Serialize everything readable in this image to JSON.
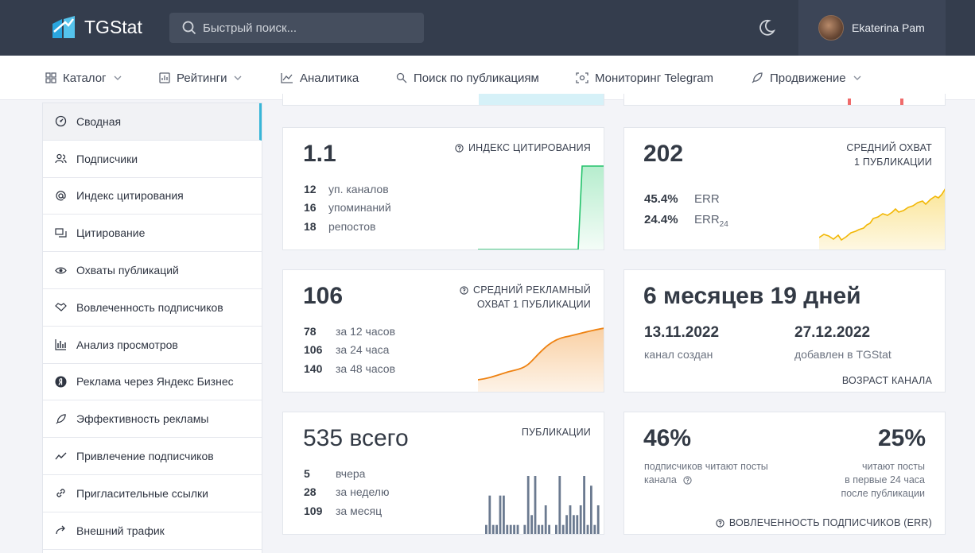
{
  "app": {
    "name": "TGStat"
  },
  "search": {
    "placeholder": "Быстрый поиск..."
  },
  "user": {
    "name": "Ekaterina Pam"
  },
  "nav": [
    {
      "label": "Каталог",
      "icon": "grid-icon",
      "dropdown": true
    },
    {
      "label": "Рейтинги",
      "icon": "bar-chart-icon",
      "dropdown": true
    },
    {
      "label": "Аналитика",
      "icon": "line-chart-icon",
      "dropdown": false
    },
    {
      "label": "Поиск по публикациям",
      "icon": "search-icon",
      "dropdown": false
    },
    {
      "label": "Мониторинг Telegram",
      "icon": "monitor-icon",
      "dropdown": false
    },
    {
      "label": "Продвижение",
      "icon": "rocket-icon",
      "dropdown": true
    }
  ],
  "sidebar": [
    {
      "label": "Сводная",
      "icon": "dashboard-icon",
      "active": true
    },
    {
      "label": "Подписчики",
      "icon": "users-icon"
    },
    {
      "label": "Индекс цитирования",
      "icon": "at-icon"
    },
    {
      "label": "Цитирование",
      "icon": "quote-icon"
    },
    {
      "label": "Охваты публикаций",
      "icon": "eye-icon"
    },
    {
      "label": "Вовлеченность подписчиков",
      "icon": "handshake-icon"
    },
    {
      "label": "Анализ просмотров",
      "icon": "bars-icon"
    },
    {
      "label": "Реклама через Яндекс Бизнес",
      "icon": "yandex-icon"
    },
    {
      "label": "Эффективность рекламы",
      "icon": "rocket-icon"
    },
    {
      "label": "Привлечение подписчиков",
      "icon": "trend-icon"
    },
    {
      "label": "Пригласительные ссылки",
      "icon": "link-icon"
    },
    {
      "label": "Внешний трафик",
      "icon": "share-icon"
    }
  ],
  "cards": {
    "citation": {
      "title": "ИНДЕКС ЦИТИРОВАНИЯ",
      "value": "1.1",
      "rows": [
        {
          "num": "12",
          "label": "уп. каналов"
        },
        {
          "num": "16",
          "label": "упоминаний"
        },
        {
          "num": "18",
          "label": "репостов"
        }
      ],
      "spark_color": "#2ecc71"
    },
    "reach": {
      "title_line1": "СРЕДНИЙ ОХВАТ",
      "title_line2": "1 ПУБЛИКАЦИИ",
      "value": "202",
      "rows": [
        {
          "num": "45.4%",
          "label": "ERR"
        },
        {
          "num": "24.4%",
          "label": "ERR",
          "sub": "24"
        }
      ],
      "spark_color": "#f5c518"
    },
    "ad_reach": {
      "title_line1": "СРЕДНИЙ РЕКЛАМНЫЙ",
      "title_line2": "ОХВАТ 1 ПУБЛИКАЦИИ",
      "value": "106",
      "rows": [
        {
          "num": "78",
          "label": "за 12 часов"
        },
        {
          "num": "106",
          "label": "за 24 часа"
        },
        {
          "num": "140",
          "label": "за 48 часов"
        }
      ],
      "spark_color": "#f08a1c"
    },
    "age": {
      "value": "6 месяцев 19 дней",
      "created_date": "13.11.2022",
      "created_label": "канал создан",
      "added_date": "27.12.2022",
      "added_label": "добавлен в TGStat",
      "footer": "ВОЗРАСТ КАНАЛА"
    },
    "posts": {
      "title": "ПУБЛИКАЦИИ",
      "value": "535 всего",
      "rows": [
        {
          "num": "5",
          "label": "вчера"
        },
        {
          "num": "28",
          "label": "за неделю"
        },
        {
          "num": "109",
          "label": "за месяц"
        }
      ],
      "bar_color": "#6b7a90",
      "bars": [
        1,
        4,
        1,
        1,
        4,
        4,
        1,
        1,
        1,
        1,
        0,
        1,
        6,
        2,
        6,
        1,
        1,
        3,
        1,
        0,
        1,
        6,
        1,
        2,
        3,
        2,
        2,
        3,
        6,
        1,
        5,
        1,
        3
      ]
    },
    "engagement": {
      "left_value": "46%",
      "left_label_line1": "подписчиков читают посты",
      "left_label_line2": "канала",
      "right_value": "25%",
      "right_label_line1": "читают посты",
      "right_label_line2": "в первые 24 часа",
      "right_label_line3": "после публикации",
      "footer": "ВОВЛЕЧЕННОСТЬ ПОДПИСЧИКОВ (ERR)"
    }
  }
}
